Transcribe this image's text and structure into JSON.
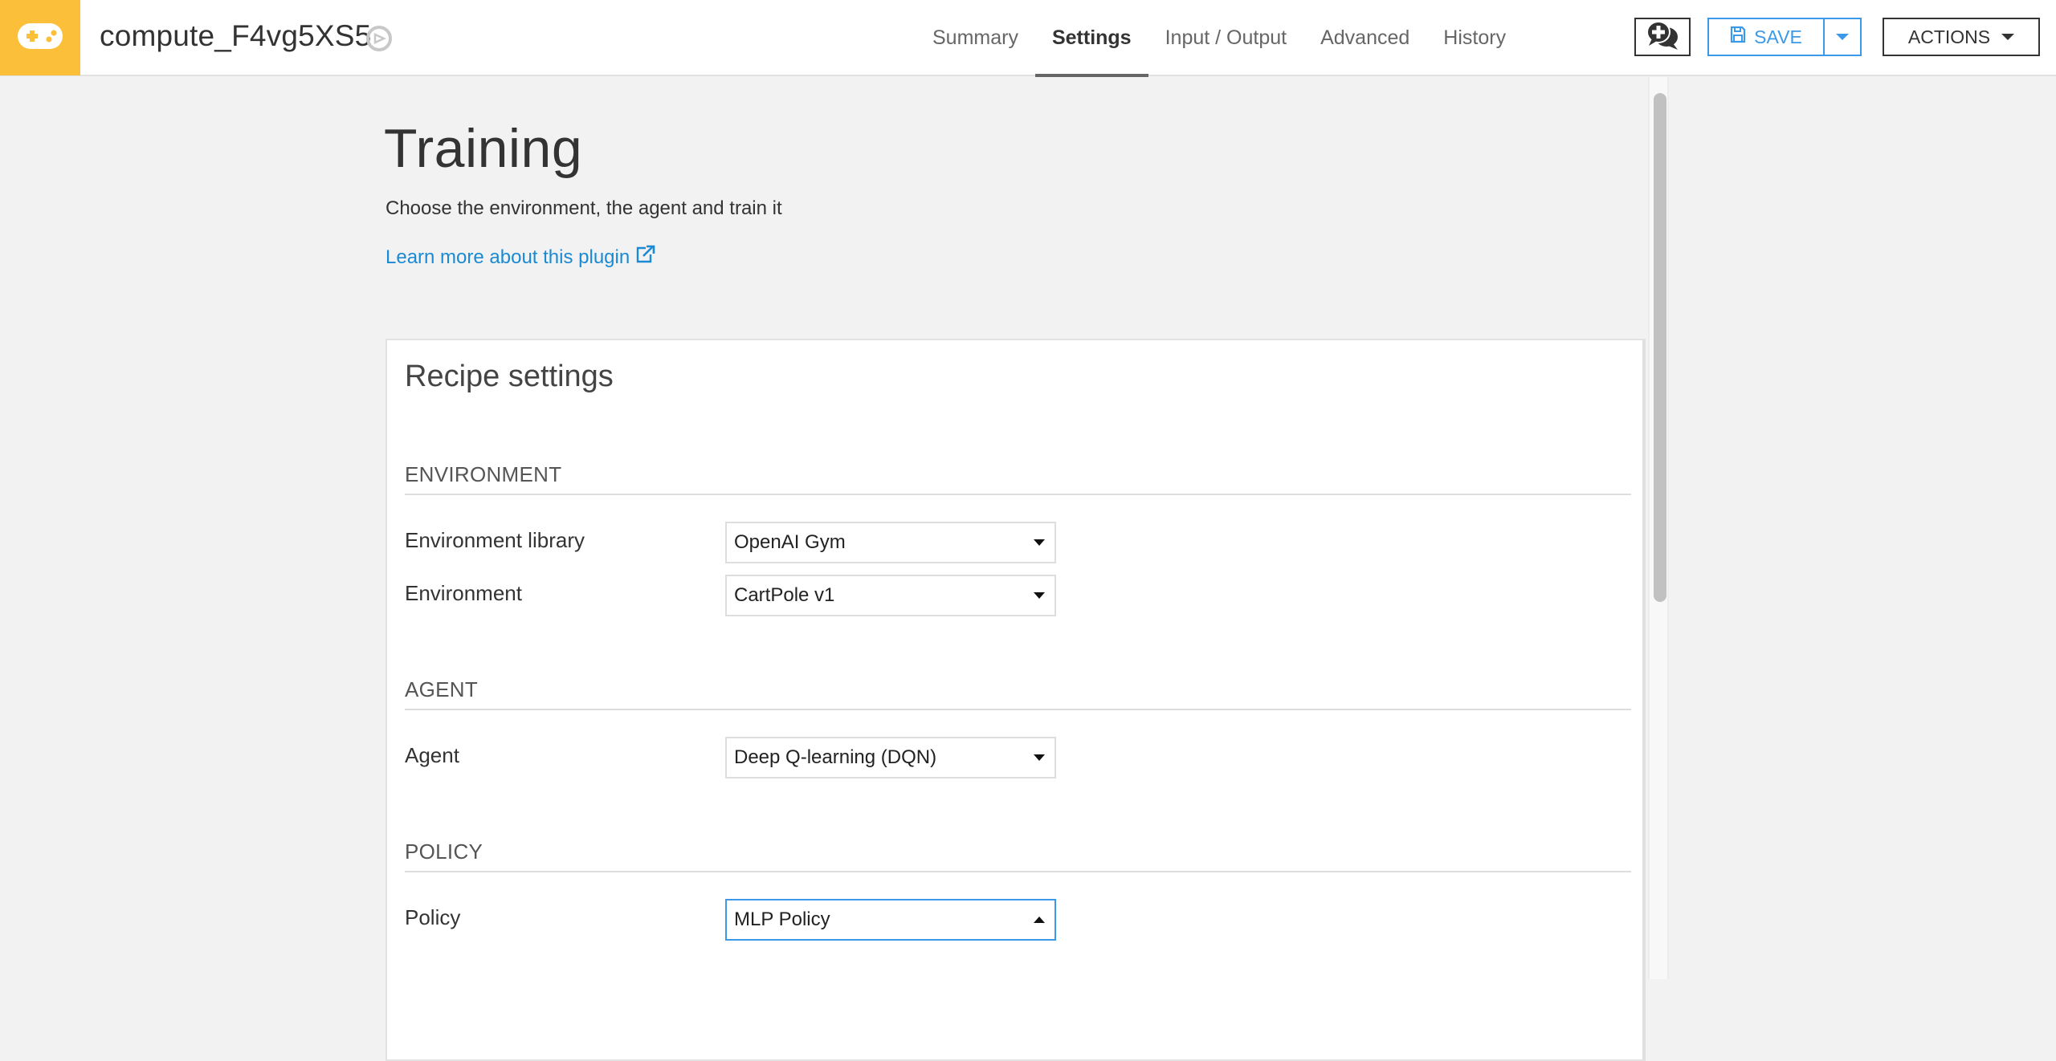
{
  "app": {
    "recipe_icon": "gamepad-icon",
    "accent_color": "#fbbf3a",
    "recipe_name": "compute_F4vg5XS5",
    "recipe_type_icon": "plugin-recipe-icon"
  },
  "nav": {
    "tabs": [
      {
        "label": "Summary",
        "active": false
      },
      {
        "label": "Settings",
        "active": true
      },
      {
        "label": "Input / Output",
        "active": false
      },
      {
        "label": "Advanced",
        "active": false
      },
      {
        "label": "History",
        "active": false
      }
    ]
  },
  "toolbar": {
    "discussions_icon": "discussion-add-icon",
    "save_label": "SAVE",
    "save_icon": "floppy-disk-icon",
    "save_color": "#3c99e8",
    "actions_label": "ACTIONS"
  },
  "page": {
    "title": "Training",
    "description": "Choose the environment, the agent and train it",
    "learn_more": "Learn more about this plugin",
    "link_color": "#1a8ad4"
  },
  "panel": {
    "title": "Recipe settings",
    "sections": [
      {
        "title": "ENVIRONMENT",
        "fields": [
          {
            "label": "Environment library",
            "value": "OpenAI Gym",
            "open": false
          },
          {
            "label": "Environment",
            "value": "CartPole v1",
            "open": false
          }
        ]
      },
      {
        "title": "AGENT",
        "fields": [
          {
            "label": "Agent",
            "value": "Deep Q-learning (DQN)",
            "open": false
          }
        ]
      },
      {
        "title": "POLICY",
        "fields": [
          {
            "label": "Policy",
            "value": "MLP Policy",
            "open": true
          }
        ]
      }
    ]
  }
}
